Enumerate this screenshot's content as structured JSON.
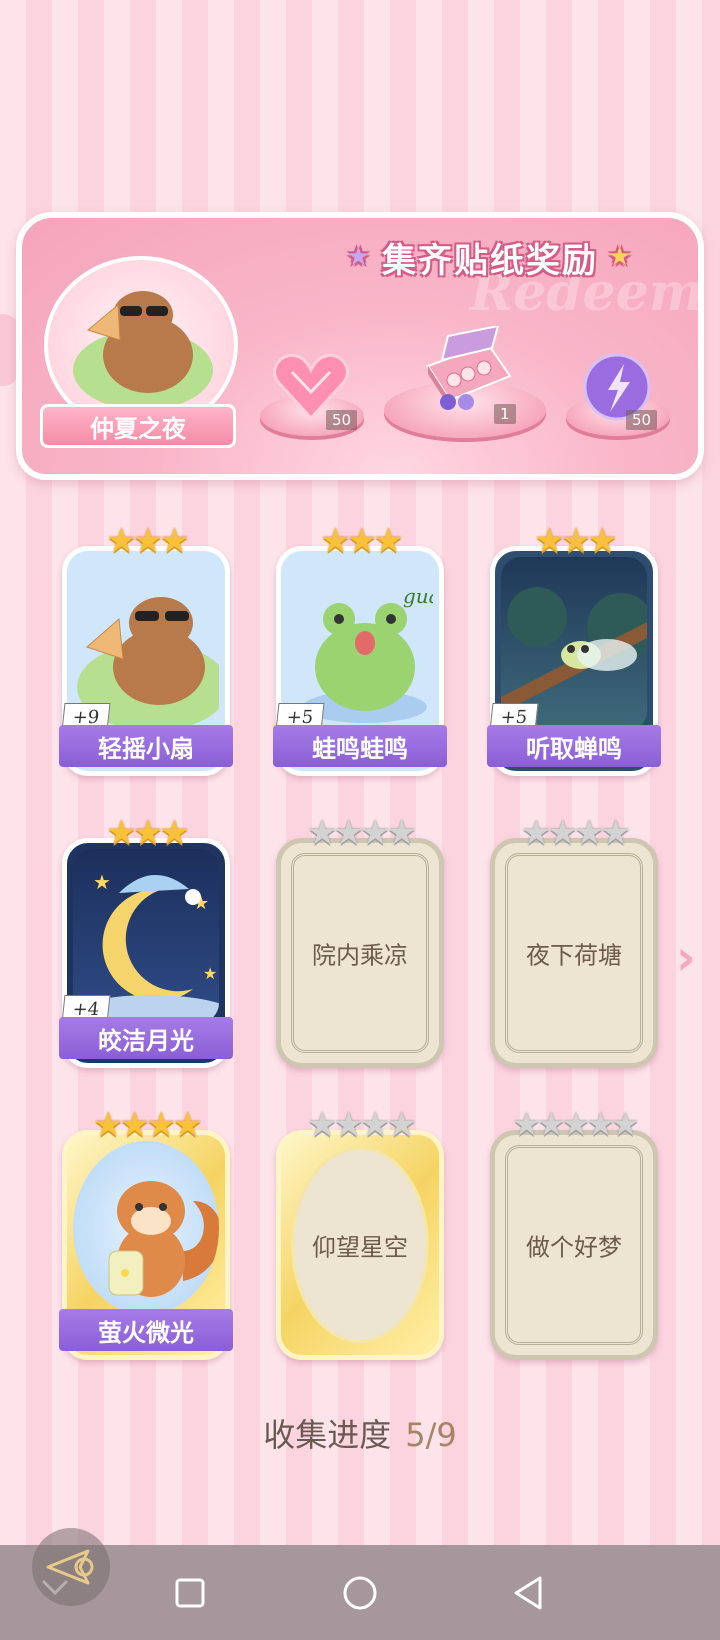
{
  "banner": {
    "title": "集齐贴纸奖励",
    "watermark": "Redeem",
    "season_label": "仲夏之夜",
    "rewards": [
      {
        "icon": "pink-heart-gem-icon",
        "count": "50"
      },
      {
        "icon": "gift-box-icon",
        "count": "1"
      },
      {
        "icon": "purple-lightning-orb-icon",
        "count": "50"
      }
    ]
  },
  "cards": [
    {
      "name": "轻摇小扇",
      "stars": 3,
      "max_stars": 3,
      "unlocked": true,
      "bonus": "+9",
      "art": "capybara-fan"
    },
    {
      "name": "蛙鸣蛙鸣",
      "stars": 3,
      "max_stars": 3,
      "unlocked": true,
      "bonus": "+5",
      "art": "frog",
      "art_text": "gua"
    },
    {
      "name": "听取蝉鸣",
      "stars": 3,
      "max_stars": 3,
      "unlocked": true,
      "bonus": "+5",
      "art": "cicada"
    },
    {
      "name": "皎洁月光",
      "stars": 3,
      "max_stars": 3,
      "unlocked": true,
      "bonus": "+4",
      "art": "moon"
    },
    {
      "name": "院内乘凉",
      "stars": 0,
      "max_stars": 4,
      "unlocked": false
    },
    {
      "name": "夜下荷塘",
      "stars": 0,
      "max_stars": 4,
      "unlocked": false
    },
    {
      "name": "萤火微光",
      "stars": 4,
      "max_stars": 4,
      "unlocked": true,
      "art": "squirrel",
      "gold_frame": true
    },
    {
      "name": "仰望星空",
      "stars": 0,
      "max_stars": 4,
      "unlocked": false,
      "gold_frame": true
    },
    {
      "name": "做个好梦",
      "stars": 0,
      "max_stars": 5,
      "unlocked": false
    }
  ],
  "progress": {
    "label": "收集进度",
    "value": "5/9"
  },
  "nav": {
    "icons": [
      "chevron-down-icon",
      "recent-apps-icon",
      "home-icon",
      "back-icon"
    ],
    "float_icon": "floating-back-icon"
  },
  "colors": {
    "label_purple": "#8a5fd6",
    "star_gold": "#f7c23a",
    "banner_pink": "#f5a4bb"
  }
}
